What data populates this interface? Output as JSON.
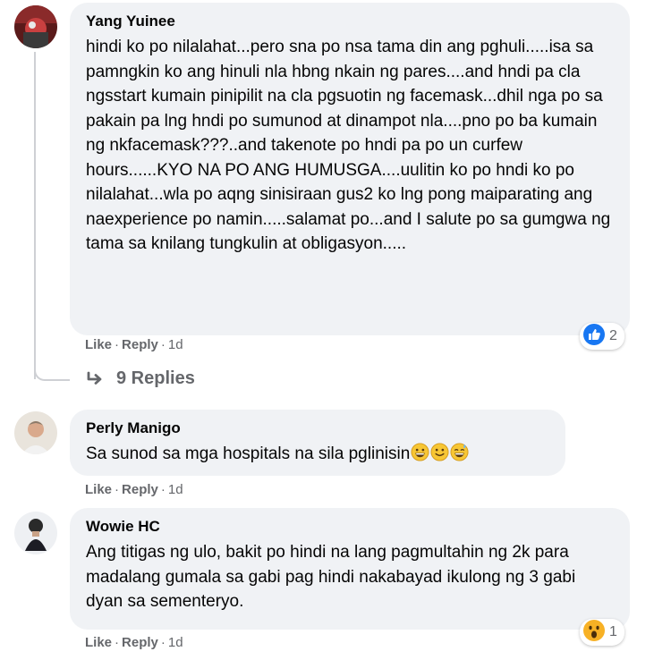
{
  "comments": [
    {
      "author": "Yang Yuinee",
      "text": "hindi ko po nilalahat...pero sna po nsa tama din ang pghuli.....isa sa pamngkin ko ang hinuli nla hbng nkain ng pares....and hndi pa cla ngsstart kumain pinipilit na cla pgsuotin ng facemask...dhil nga po sa pakain pa lng hndi po sumunod at dinampot nla....pno po ba kumain ng nkfacemask???..and takenote po hndi pa po un curfew hours......KYO NA PO ANG HUMUSGA....uulitin ko po hndi ko po nilalahat...wla po aqng sinisiraan gus2 ko lng pong maiparating ang naexperience po namin.....salamat po...and I salute po sa gumgwa ng tama sa knilang tungkulin at obligasyon.....",
      "like": "Like",
      "reply": "Reply",
      "time": "1d",
      "reaction_count": "2",
      "reaction_icon": "like-reaction-icon",
      "replies_label": "9 Replies"
    },
    {
      "author": "Perly Manigo",
      "text": "Sa sunod sa mga hospitals na sila pglinisin",
      "emojis": [
        "grinning-face-icon",
        "slightly-smiling-face-icon",
        "grinning-sweat-face-icon"
      ],
      "like": "Like",
      "reply": "Reply",
      "time": "1d"
    },
    {
      "author": "Wowie HC",
      "text": "Ang titigas ng ulo, bakit po hindi na lang pagmultahin ng 2k para madalang gumala sa gabi pag hindi nakabayad ikulong ng 3 gabi dyan sa sementeryo.",
      "like": "Like",
      "reply": "Reply",
      "time": "1d",
      "reaction_count": "1",
      "reaction_icon": "wow-reaction-icon"
    }
  ],
  "colors": {
    "bubble": "#f0f2f5",
    "meta_text": "#65676b",
    "like_blue": "#1877f2",
    "wow_yellow": "#f7b125"
  }
}
